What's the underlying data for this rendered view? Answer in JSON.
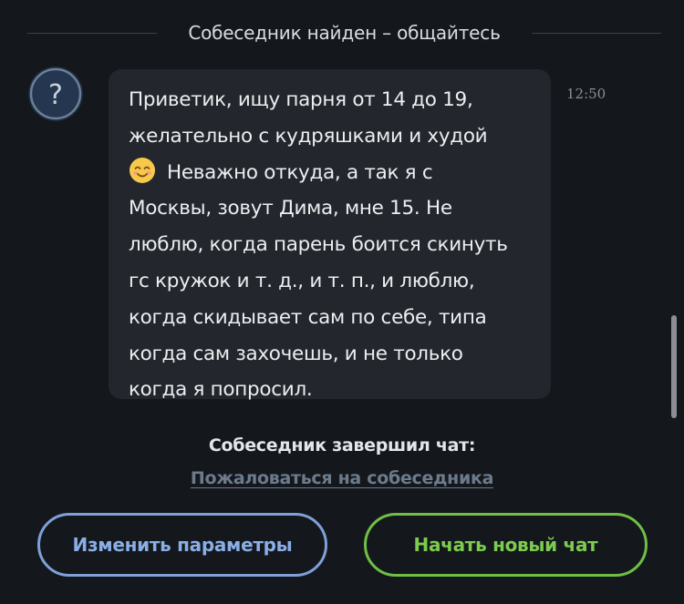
{
  "header": {
    "status_text": "Собеседник найден – общайтесь"
  },
  "message": {
    "avatar_icon": "question-mark-icon",
    "lines": [
      "Приветик, ищу парня от 14 до 19,",
      "желательно с кудряшками и худой",
      "Неважно откуда, а так я с",
      "Москвы, зовут Дима, мне 15. Не",
      "люблю, когда парень боится скинуть",
      "гс кружок и т. д., и т. п., и люблю,",
      "когда скидывает сам по себе, типа",
      "когда сам захочешь, и не только",
      "когда я попросил."
    ],
    "emoji": "smiling-face-emoji",
    "time": "12:50"
  },
  "footer": {
    "ended_text": "Собеседник завершил чат:",
    "report_link": "Пожаловаться на собеседника",
    "change_params_label": "Изменить параметры",
    "new_chat_label": "Начать новый чат"
  },
  "colors": {
    "background": "#14181d",
    "bubble": "#23272d",
    "params_button": "#7fa0d8",
    "new_chat_button": "#6fbf45"
  }
}
